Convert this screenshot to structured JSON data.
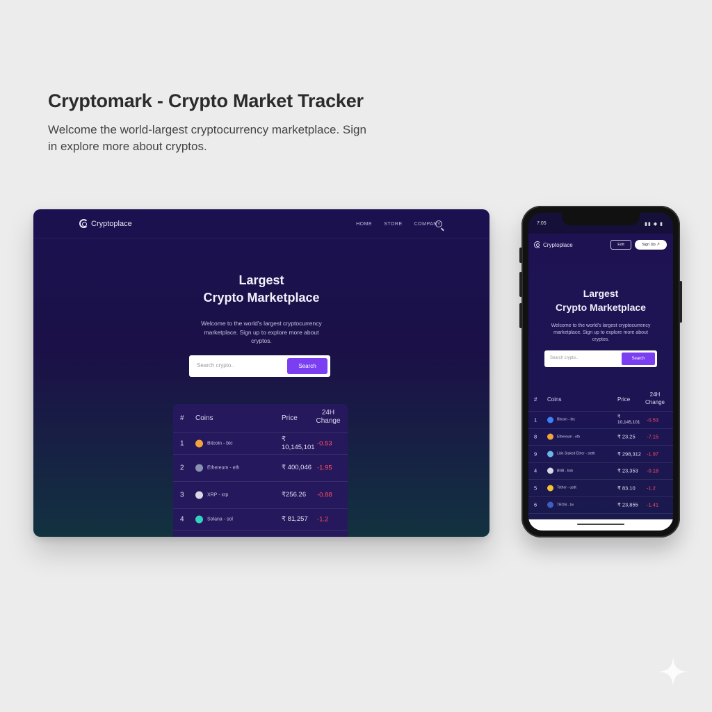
{
  "page": {
    "title": "Cryptomark - Crypto Market Tracker",
    "subtitle": "Welcome the world-largest cryptocurrency marketplace. Sign in explore more about cryptos."
  },
  "desktop": {
    "brand": "Cryptoplace",
    "nav_links": [
      "HOME",
      "STORE",
      "COMPANY"
    ],
    "hero_title_line1": "Largest",
    "hero_title_line2": "Crypto Marketplace",
    "hero_description": "Welcome to the world's largest cryptocurrency marketplace. Sign up to explore more about cryptos.",
    "search_placeholder": "Search crypto..",
    "search_button": "Search",
    "table": {
      "headers": [
        "#",
        "Coins",
        "Price",
        "24H Change"
      ],
      "rows": [
        {
          "rank": "1",
          "coin": "Bitcoin - btc",
          "price": "₹ 10,145,101",
          "change": "-0.53",
          "icon_color": "#f2a33a"
        },
        {
          "rank": "2",
          "coin": "Ethereum - eth",
          "price": "₹ 400,046",
          "change": "-1.95",
          "icon_color": "#8a92b2"
        },
        {
          "rank": "3",
          "coin": "XRP - xrp",
          "price": "₹256.26",
          "change": "-0.88",
          "icon_color": "#d9d9e6"
        },
        {
          "rank": "4",
          "coin": "Solana - sol",
          "price": "₹ 81,257",
          "change": "-1.2",
          "icon_color": "#32d1c0"
        }
      ]
    }
  },
  "phone": {
    "status_time": "7:05",
    "status_icons": "▮▮ ◆ ▮",
    "brand": "Cryptoplace",
    "login_button": "Edit",
    "signup_button": "Sign Up ↗",
    "hero_title_line1": "Largest",
    "hero_title_line2": "Crypto Marketplace",
    "hero_description": "Welcome to the world's largest cryptocurrency marketplace. Sign up to explore more about cryptos.",
    "search_placeholder": "Search crypto..",
    "search_button": "Search",
    "table": {
      "headers": [
        "#",
        "Coins",
        "Price",
        "24H Change"
      ],
      "rows": [
        {
          "rank": "1",
          "coin": "Bitcoin - btc",
          "price": "₹ 10,145,101",
          "change": "-0.53",
          "icon_color": "#3b82f6"
        },
        {
          "rank": "8",
          "coin": "Ethereum - eth",
          "price": "₹ 23.25",
          "change": "-7.15",
          "icon_color": "#f2a33a"
        },
        {
          "rank": "9",
          "coin": "Lido Staked Ether - steth",
          "price": "₹ 298,312",
          "change": "-1.97",
          "icon_color": "#6ab7e8"
        },
        {
          "rank": "4",
          "coin": "BNB - bnb",
          "price": "₹ 23,353",
          "change": "-0.18",
          "icon_color": "#d9d9e6"
        },
        {
          "rank": "5",
          "coin": "Tether - usdt",
          "price": "₹ 83.10",
          "change": "-1.2",
          "icon_color": "#f2c230"
        },
        {
          "rank": "6",
          "coin": "TRON - trx",
          "price": "₹ 23,855",
          "change": "-1.41",
          "icon_color": "#3e5fc2"
        }
      ]
    }
  },
  "colors": {
    "accent": "#7b3ff2",
    "negative": "#ff4f5e",
    "dark_bg": "#1b1150"
  }
}
